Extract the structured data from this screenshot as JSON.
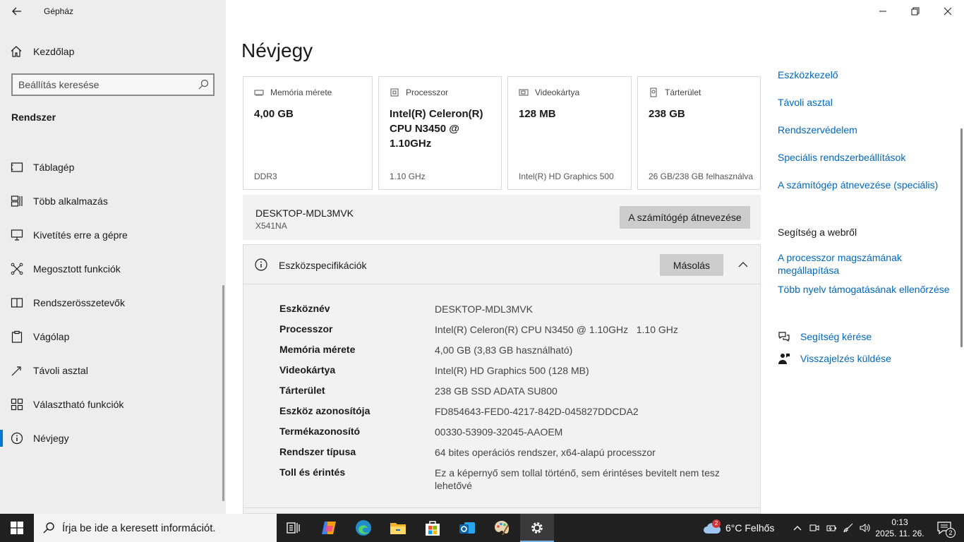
{
  "window": {
    "app_title": "Gépház"
  },
  "sidebar": {
    "home_label": "Kezdőlap",
    "search_placeholder": "Beállítás keresése",
    "section_title": "Rendszer",
    "items": [
      {
        "label": "Táblagép",
        "icon": "tablet-icon"
      },
      {
        "label": "Több alkalmazás",
        "icon": "multitasking-icon"
      },
      {
        "label": "Kivetítés erre a gépre",
        "icon": "projecting-icon"
      },
      {
        "label": "Megosztott funkciók",
        "icon": "shared-experiences-icon"
      },
      {
        "label": "Rendszerösszetevők",
        "icon": "system-components-icon"
      },
      {
        "label": "Vágólap",
        "icon": "clipboard-icon"
      },
      {
        "label": "Távoli asztal",
        "icon": "remote-desktop-icon"
      },
      {
        "label": "Választható funkciók",
        "icon": "optional-features-icon"
      },
      {
        "label": "Névjegy",
        "icon": "info-icon",
        "active": true
      }
    ]
  },
  "main": {
    "title": "Névjegy",
    "cards": [
      {
        "label": "Memória mérete",
        "value": "4,00 GB",
        "sub": "DDR3",
        "icon": "memory-icon"
      },
      {
        "label": "Processzor",
        "value": "Intel(R) Celeron(R) CPU N3450 @ 1.10GHz",
        "sub": "1.10 GHz",
        "icon": "processor-icon"
      },
      {
        "label": "Videokártya",
        "value": "128 MB",
        "sub": "Intel(R) HD Graphics 500",
        "icon": "graphics-card-icon"
      },
      {
        "label": "Tárterület",
        "value": "238 GB",
        "sub": "26 GB/238 GB felhasználva",
        "icon": "storage-icon"
      }
    ],
    "pc": {
      "name": "DESKTOP-MDL3MVK",
      "model": "X541NA",
      "rename_label": "A számítógép átnevezése"
    },
    "specs": {
      "title": "Eszközspecifikációk",
      "copy_label": "Másolás",
      "rows": [
        {
          "key": "Eszköznév",
          "value": "DESKTOP-MDL3MVK"
        },
        {
          "key": "Processzor",
          "value": "Intel(R) Celeron(R) CPU N3450 @ 1.10GHz   1.10 GHz"
        },
        {
          "key": "Memória mérete",
          "value": "4,00 GB (3,83 GB használható)"
        },
        {
          "key": "Videokártya",
          "value": "Intel(R) HD Graphics 500 (128 MB)"
        },
        {
          "key": "Tárterület",
          "value": "238 GB SSD ADATA SU800"
        },
        {
          "key": "Eszköz azonosítója",
          "value": "FD854643-FED0-4217-842D-045827DDCDA2"
        },
        {
          "key": "Termékazonosító",
          "value": "00330-53909-32045-AAOEM"
        },
        {
          "key": "Rendszer típusa",
          "value": "64 bites operációs rendszer, x64-alapú processzor"
        },
        {
          "key": "Toll és érintés",
          "value": "Ez a képernyő sem tollal történő, sem érintéses bevitelt nem tesz lehetővé"
        }
      ]
    }
  },
  "related": {
    "links": [
      "Eszközkezelő",
      "Távoli asztal",
      "Rendszervédelem",
      "Speciális rendszerbeállítások",
      "A számítógép átnevezése (speciális)"
    ],
    "web_help_title": "Segítség a webről",
    "web_links": [
      "A processzor magszámának megállapítása",
      "Több nyelv támogatásának ellenőrzése"
    ],
    "get_help": "Segítség kérése",
    "feedback": "Visszajelzés küldése"
  },
  "taskbar": {
    "search_placeholder": "Írja be ide a keresett információt.",
    "weather": "6°C  Felhős",
    "weather_badge": "2",
    "time": "0:13",
    "date": "2025. 11. 26.",
    "notification_count": "2"
  },
  "colors": {
    "accent": "#0078d4",
    "link": "#0067c0",
    "taskbar": "#202020"
  }
}
